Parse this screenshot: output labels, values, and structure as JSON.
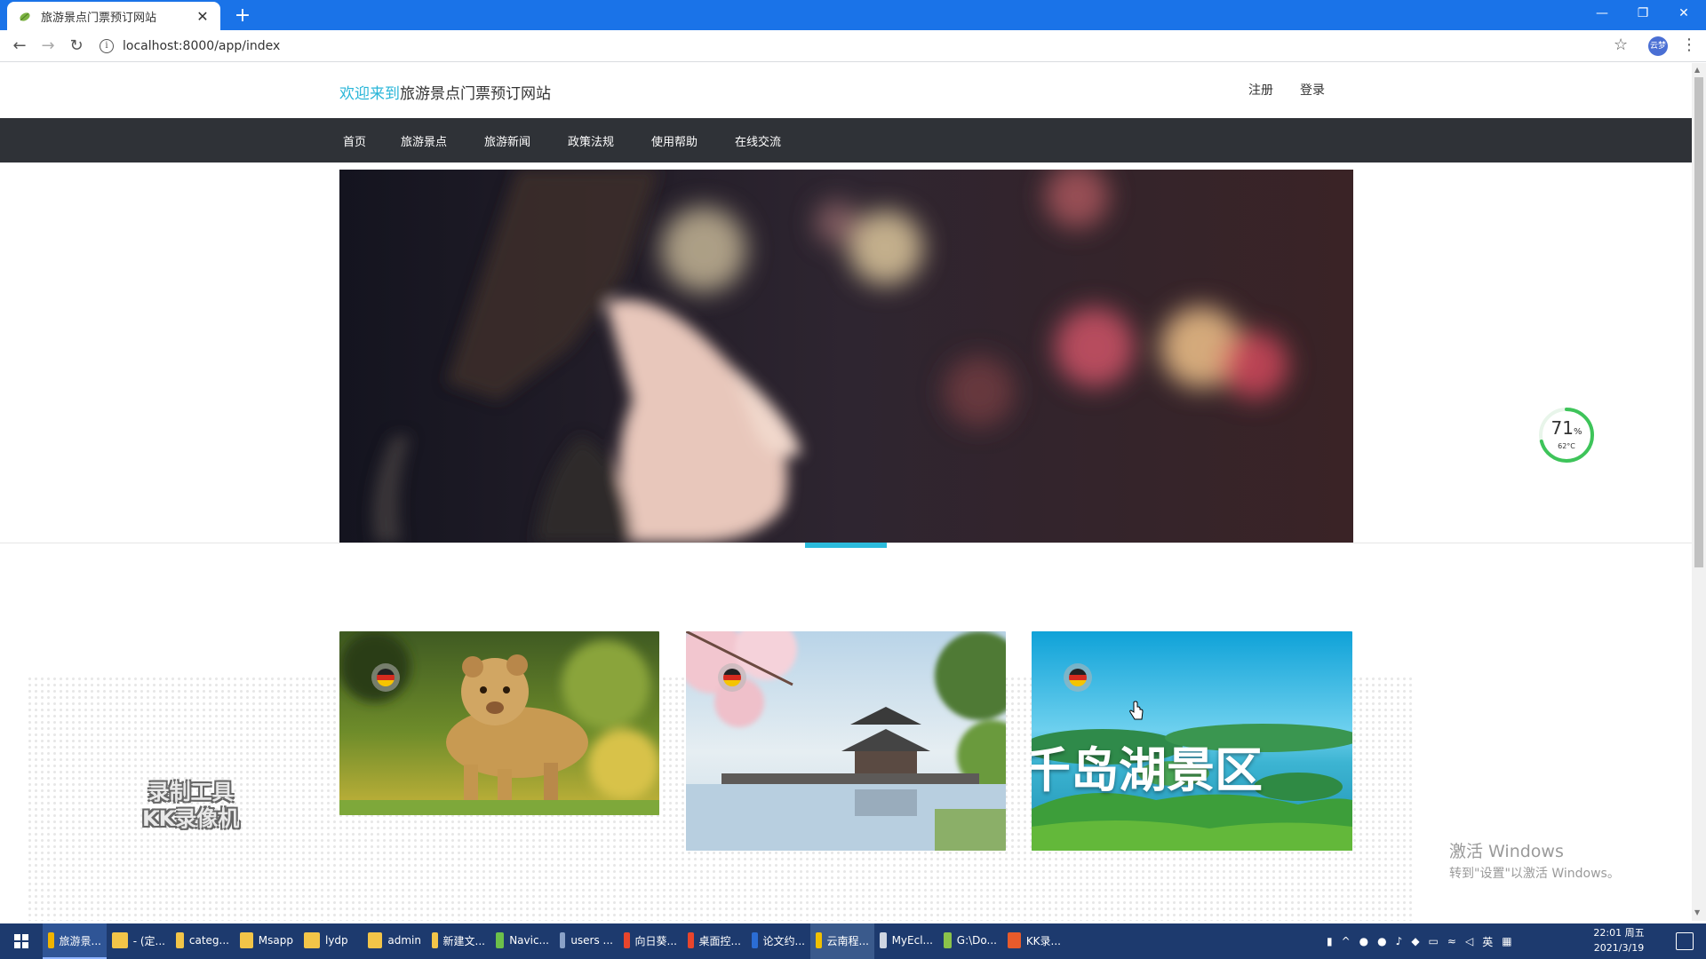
{
  "browser": {
    "tab_title": "旅游景点门票预订网站",
    "tab_close": "✕",
    "new_tab": "+",
    "url": "localhost:8000/app/index",
    "info_glyph": "i",
    "profile_label": "云梦",
    "window_controls": {
      "minimize": "—",
      "restore": "❐",
      "close": "✕"
    }
  },
  "header": {
    "welcome_accent": "欢迎来到",
    "site_name": "旅游景点门票预订网站",
    "register": "注册",
    "login": "登录"
  },
  "nav": {
    "items": [
      "首页",
      "旅游景点",
      "旅游新闻",
      "政策法规",
      "使用帮助",
      "在线交流"
    ]
  },
  "cards": [
    {
      "subject": "lion cub on grass"
    },
    {
      "subject": "pavilion by lake with cherry blossoms"
    },
    {
      "subject": "lake islands aerial view",
      "caption": "千岛湖景区"
    }
  ],
  "overlays": {
    "watermark_line1": "录制工具",
    "watermark_line2": "KK录像机",
    "gauge_percent": "71",
    "gauge_percent_sign": "%",
    "gauge_temp": "62°C",
    "gauge_level": 0.71,
    "activate_title": "激活 Windows",
    "activate_sub": "转到\"设置\"以激活 Windows。"
  },
  "taskbar": {
    "items": [
      {
        "label": "旅游景...",
        "color": "#f0b400"
      },
      {
        "label": "- (定...",
        "color": "#f3c548"
      },
      {
        "label": "categ...",
        "color": "#f3c548"
      },
      {
        "label": "Msapp",
        "color": "#f3c548"
      },
      {
        "label": "lydp",
        "color": "#f3c548"
      },
      {
        "label": "admin",
        "color": "#f3c548"
      },
      {
        "label": "新建文...",
        "color": "#f3c548"
      },
      {
        "label": "Navic...",
        "color": "#6cc04a"
      },
      {
        "label": "users ...",
        "color": "#8aa2c8"
      },
      {
        "label": "向日葵...",
        "color": "#e8452c"
      },
      {
        "label": "桌面控...",
        "color": "#e8452c"
      },
      {
        "label": "论文约...",
        "color": "#2b6dd4"
      },
      {
        "label": "云南程...",
        "color": "#f0c000"
      },
      {
        "label": "MyEcl...",
        "color": "#cfd6e2"
      },
      {
        "label": "G:\\Do...",
        "color": "#8bc34a"
      },
      {
        "label": "KK录...",
        "color": "#e85b2b"
      }
    ],
    "tray_lang": "英",
    "clock_time": "22:01 周五",
    "clock_date": "2021/3/19"
  }
}
